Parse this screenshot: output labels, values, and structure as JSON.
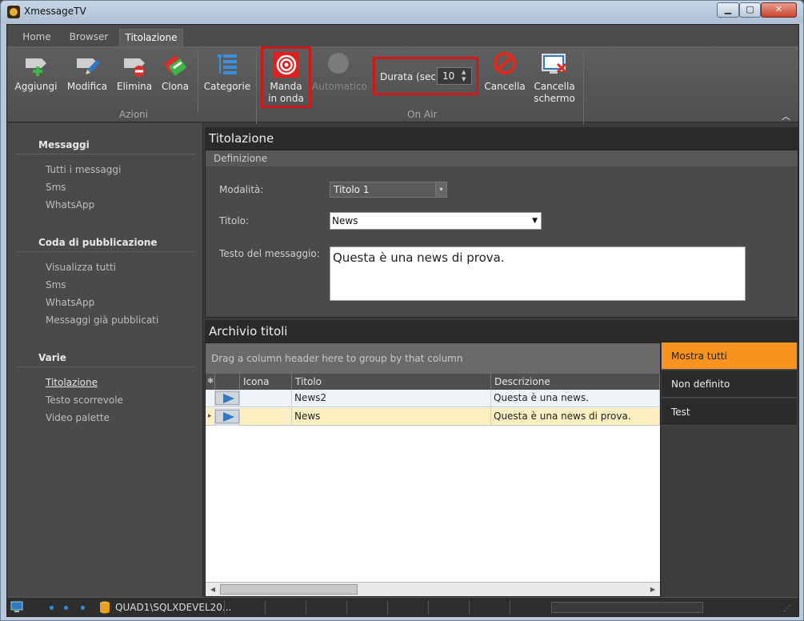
{
  "window": {
    "title": "XmessageTV",
    "min_symbol": "▁",
    "max_symbol": "▢",
    "close_symbol": "✕"
  },
  "tabs": [
    {
      "label": "Home"
    },
    {
      "label": "Browser"
    },
    {
      "label": "Titolazione",
      "active": true
    }
  ],
  "ribbon": {
    "actions": {
      "label": "Azioni",
      "buttons": [
        {
          "label": "Aggiungi",
          "icon": "add-message-icon"
        },
        {
          "label": "Modifica",
          "icon": "edit-message-icon"
        },
        {
          "label": "Elimina",
          "icon": "delete-message-icon"
        },
        {
          "label": "Clona",
          "icon": "clone-icon"
        }
      ],
      "categories_label": "Categorie"
    },
    "onair": {
      "label": "On Air",
      "send_line1": "Manda",
      "send_line2": "in onda",
      "automatic": "Automatico",
      "duration_label": "Durata (sec.)",
      "duration_value": "10",
      "spin_up": "▲",
      "spin_down": "▼",
      "cancel": "Cancella",
      "clear_line1": "Cancella",
      "clear_line2": "schermo"
    },
    "collapse_symbol": "︿"
  },
  "nav": {
    "messages_head": "Messaggi",
    "messages": [
      "Tutti i messaggi",
      "Sms",
      "WhatsApp"
    ],
    "queue_head": "Coda di pubblicazione",
    "queue": [
      "Visualizza tutti",
      "Sms",
      "WhatsApp",
      "Messaggi già pubblicati"
    ],
    "misc_head": "Varie",
    "misc": [
      "Titolazione",
      "Testo scorrevole",
      "Video palette"
    ],
    "selected": "Titolazione"
  },
  "titolazione": {
    "title": "Titolazione",
    "section": "Definizione",
    "mode_label": "Modalità:",
    "mode_value": "Titolo 1",
    "title_label": "Titolo:",
    "title_value": "News",
    "text_label": "Testo del messaggio:",
    "text_value": "Questa è una news di prova.",
    "dd_small": "▾",
    "dd_big": "▼"
  },
  "archive": {
    "title": "Archivio titoli",
    "group_hint": "Drag a column header here to group by that column",
    "star": "✱",
    "columns": [
      "Icona",
      "Titolo",
      "Descrizione"
    ],
    "rows": [
      {
        "titolo": "News2",
        "descrizione": "Questa è una news."
      },
      {
        "titolo": "News",
        "descrizione": "Questa è una news di prova."
      }
    ],
    "row_indicator": "▸",
    "scroll_left": "◀",
    "scroll_right": "▶"
  },
  "categories": [
    {
      "label": "Mostra tutti",
      "active": true
    },
    {
      "label": "Non definito"
    },
    {
      "label": "Test"
    }
  ],
  "status": {
    "server": "QUAD1\\SQLXDEVEL20...",
    "grip": "⋰"
  },
  "colors": {
    "accent": "#f7931e",
    "highlight_box": "#d01818",
    "play": "#2f78c4"
  }
}
